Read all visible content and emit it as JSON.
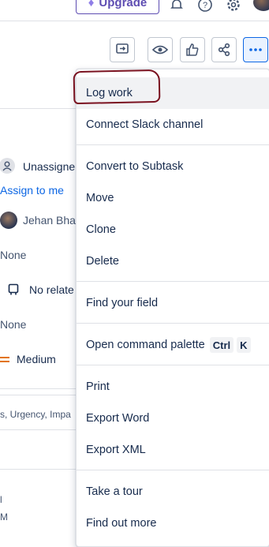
{
  "topbar": {
    "upgrade_label": "Upgrade",
    "icons": [
      "diamond-icon",
      "bell-icon",
      "help-icon",
      "settings-icon",
      "avatar"
    ]
  },
  "actions": {
    "buttons": [
      "feedback-icon",
      "watch-icon",
      "like-icon",
      "share-icon",
      "more-icon"
    ],
    "active_color": "#0c66e4"
  },
  "left_panel": {
    "assignee": "Unassigne",
    "assign_to_me": "Assign to me",
    "reporter": "Jehan Bha",
    "none_1": "None",
    "related": "No relate",
    "none_2": "None",
    "priority": "Medium",
    "labels_text": "s, Urgency, Impa",
    "line_a": "l",
    "line_b": "M"
  },
  "menu": {
    "items": [
      "Log work",
      "Connect Slack channel",
      "Convert to Subtask",
      "Move",
      "Clone",
      "Delete",
      "Find your field",
      "Open command palette",
      "Print",
      "Export Word",
      "Export XML",
      "Take a tour",
      "Find out more"
    ],
    "shortcut_keys": [
      "Ctrl",
      "K"
    ],
    "highlight_color": "#7a1220"
  },
  "colors": {
    "brand_purple": "#5e4db2",
    "link_blue": "#0c66e4",
    "priority_orange": "#e2740f"
  }
}
